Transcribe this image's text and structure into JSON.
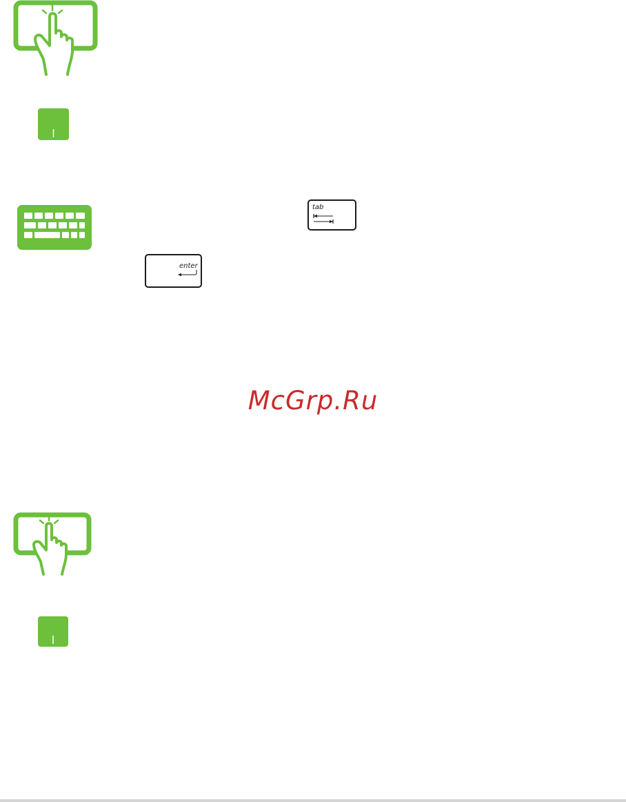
{
  "colors": {
    "icon_green": "#6cc03c",
    "watermark_red": "#c82b2b",
    "key_border": "#1a1a1a",
    "rule": "#d4d4d4"
  },
  "icons": {
    "touch_top": "touchscreen-tap-icon",
    "touchpad_top": "touchpad-icon",
    "keyboard": "keyboard-icon",
    "touch_bottom": "touchscreen-tap-icon",
    "touchpad_bottom": "touchpad-icon"
  },
  "keys": {
    "tab_label": "tab",
    "enter_label": "enter"
  },
  "watermark": {
    "text": "McGrp.Ru"
  }
}
